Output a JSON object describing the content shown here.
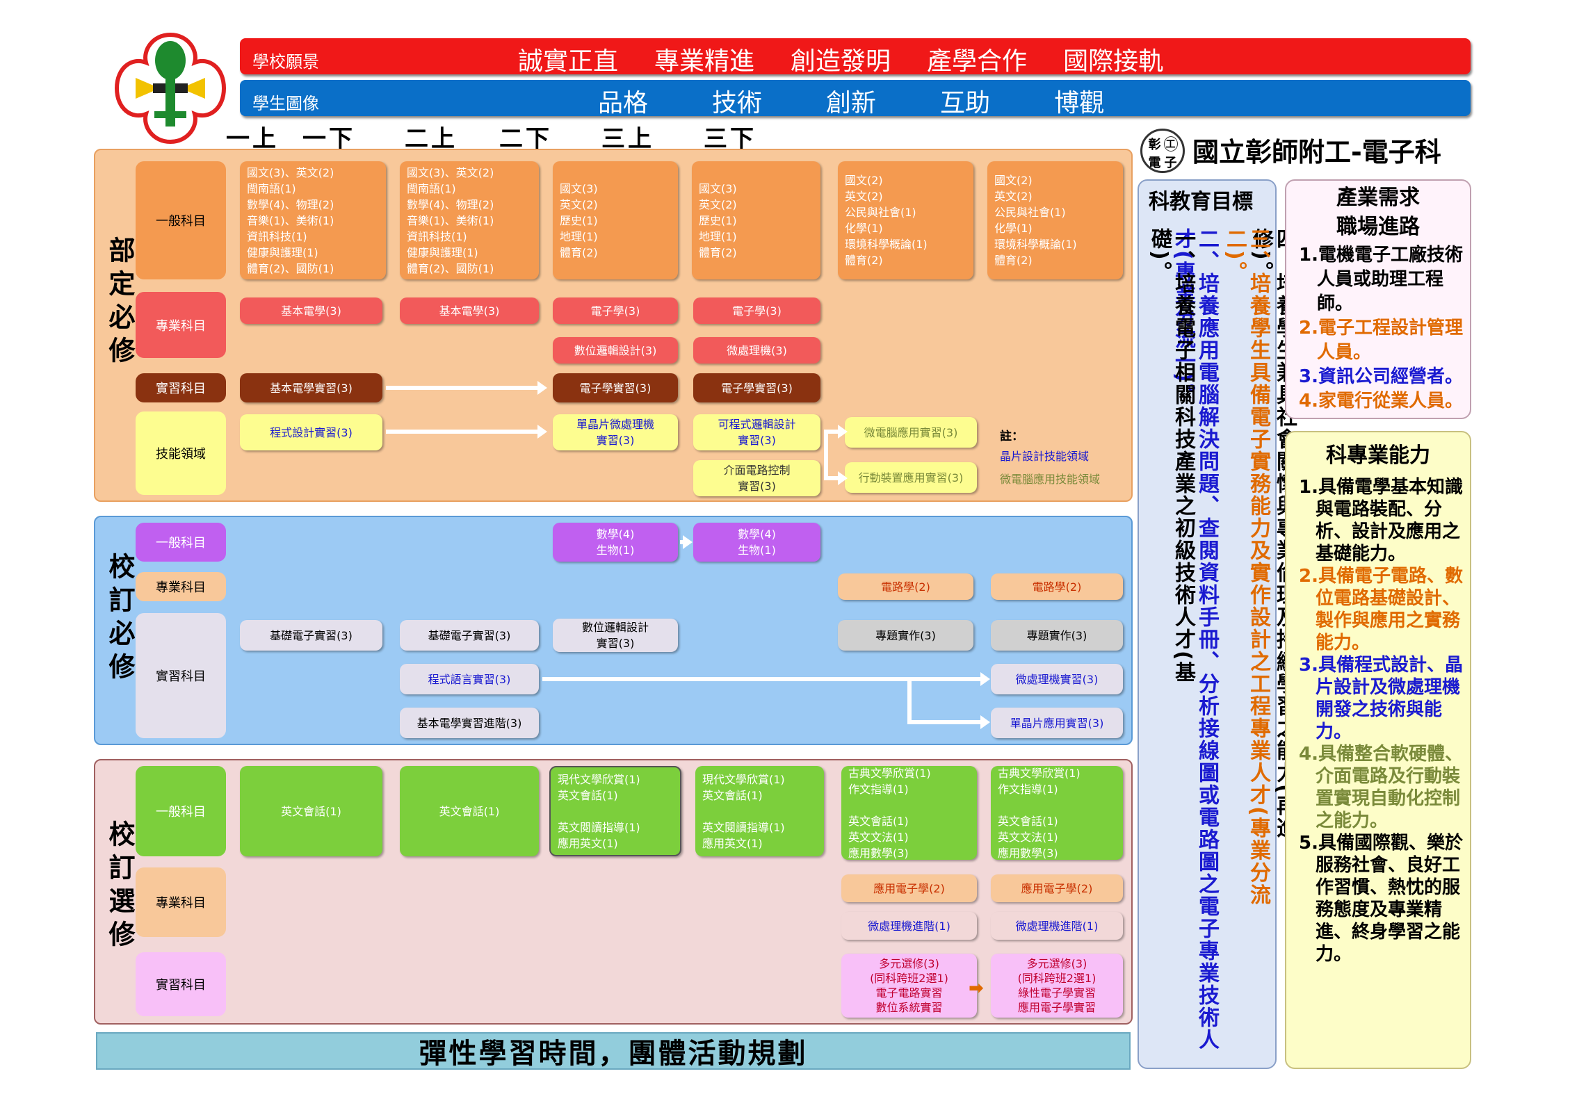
{
  "header": {
    "vision_label": "學校願景",
    "vision_items": [
      "誠實正直",
      "專業精進",
      "創造發明",
      "產學合作",
      "國際接軌"
    ],
    "image_label": "學生圖像",
    "image_items": [
      "品格",
      "技術",
      "創新",
      "互助",
      "博觀"
    ],
    "semesters": [
      "一上",
      "一下",
      "二上",
      "二下",
      "三上",
      "三下"
    ],
    "school_badge": [
      "彰",
      "工",
      "電",
      "子"
    ],
    "school_name": "國立彰師附工-電子科"
  },
  "sections": {
    "dept_required": "部定必修",
    "school_required": "校訂必修",
    "school_elective": "校訂選修"
  },
  "categories": {
    "general": "一般科目",
    "professional": "專業科目",
    "practical": "實習科目",
    "skill": "技能領域"
  },
  "dept": {
    "general": [
      "國文(3)、英文(2)\n閩南語(1)\n數學(4)、物理(2)\n音樂(1)、美術(1)\n資訊科技(1)\n健康與護理(1)\n體育(2)、國防(1)",
      "國文(3)、英文(2)\n閩南語(1)\n數學(4)、物理(2)\n音樂(1)、美術(1)\n資訊科技(1)\n健康與護理(1)\n體育(2)、國防(1)",
      "國文(3)\n英文(2)\n歷史(1)\n地理(1)\n體育(2)",
      "國文(3)\n英文(2)\n歷史(1)\n地理(1)\n體育(2)",
      "國文(2)\n英文(2)\n公民與社會(1)\n化學(1)\n環境科學概論(1)\n體育(2)",
      "國文(2)\n英文(2)\n公民與社會(1)\n化學(1)\n環境科學概論(1)\n體育(2)"
    ],
    "prof": [
      "基本電學(3)",
      "基本電學(3)",
      "電子學(3)",
      "電子學(3)",
      "數位邏輯設計(3)",
      "微處理機(3)"
    ],
    "prac": [
      "基本電學實習(3)",
      "電子學實習(3)",
      "電子學實習(3)"
    ],
    "skill": [
      "程式設計實習(3)",
      "單晶片微處理機\n實習(3)",
      "可程式邏輯設計\n實習(3)",
      "介面電路控制\n實習(3)",
      "微電腦應用實習(3)",
      "行動裝置應用實習(3)"
    ],
    "note_title": "註：",
    "note_1": "晶片設計技能領域",
    "note_2": "微電腦應用技能領域"
  },
  "school_req": {
    "general": [
      "數學(4)\n生物(1)",
      "數學(4)\n生物(1)"
    ],
    "prof": [
      "電路學(2)",
      "電路學(2)"
    ],
    "prac": [
      "基礎電子實習(3)",
      "基礎電子實習(3)",
      "數位邏輯設計\n實習(3)",
      "專題實作(3)",
      "專題實作(3)",
      "程式語言實習(3)",
      "微處理機實習(3)",
      "基本電學實習進階(3)",
      "單晶片應用實習(3)"
    ]
  },
  "elective": {
    "general": [
      "英文會話(1)",
      "英文會話(1)",
      "現代文學欣賞(1)\n英文會話(1)\n\n英文閱讀指導(1)\n應用英文(1)",
      "現代文學欣賞(1)\n英文會話(1)\n\n英文閱讀指導(1)\n應用英文(1)",
      "古典文學欣賞(1)\n作文指導(1)\n\n英文會話(1)\n英文文法(1)\n應用數學(3)",
      "古典文學欣賞(1)\n作文指導(1)\n\n英文會話(1)\n英文文法(1)\n應用數學(3)"
    ],
    "prof": [
      "應用電子學(2)",
      "應用電子學(2)",
      "微處理機進階(1)",
      "微處理機進階(1)"
    ],
    "prac": [
      "多元選修(3)\n(同科跨班2選1)\n電子電路實習\n數位系統實習",
      "多元選修(3)\n(同科跨班2選1)\n綠性電子學實習\n應用電子學實習"
    ]
  },
  "footer": "彈性學習時間，團體活動規劃",
  "goals": {
    "title": "科教育目標",
    "items": [
      "一、培養電子相關科技產業之初級技術人才(基礎)。",
      "二、培養應用電腦解決問題、查閱資料手冊、分析接線圖或電路圖之電子專業技術人才(專業分流一)。",
      "三、培養學生具備電子實務能力及實作設計之工程專業人才(專業分流二)。",
      "四、培養學生兼具社會關懷與專業倫理及持續學習之能力(再進修)。"
    ],
    "colors": [
      "#000000",
      "#1a1ad0",
      "#e06a00",
      "#000000"
    ]
  },
  "career": {
    "title": "產業需求\n職場進路",
    "items": [
      "1.電機電子工廠技術人員或助理工程師。",
      "2.電子工程設計管理人員。",
      "3.資訊公司經營者。",
      "4.家電行從業人員。"
    ],
    "colors": [
      "#000000",
      "#e06a00",
      "#1a1ad0",
      "#e06a00"
    ]
  },
  "abilities": {
    "title": "科專業能力",
    "items": [
      "1.具備電學基本知識與電路裝配、分析、設計及應用之基礎能力。",
      "2.具備電子電路、數位電路基礎設計、製作與應用之實務能力。",
      "3.具備程式設計、晶片設計及微處理機開發之技術與能力。",
      "4.具備整合軟硬體、介面電路及行動裝置實現自動化控制之能力。",
      "5.具備國際觀、樂於服務社會、良好工作習慣、熱忱的服務態度及專業精進、終身學習之能力。"
    ],
    "colors": [
      "#000000",
      "#e06a00",
      "#1a1ad0",
      "#7a8a3a",
      "#000000"
    ]
  },
  "palette": {
    "red_banner": "#f01818",
    "blue_banner": "#0a6fc8",
    "dept_bg": "#f8c89a",
    "school_req_bg": "#9ccaf4",
    "elective_bg": "#f2d8d8",
    "footer_bg": "#92cddc"
  }
}
